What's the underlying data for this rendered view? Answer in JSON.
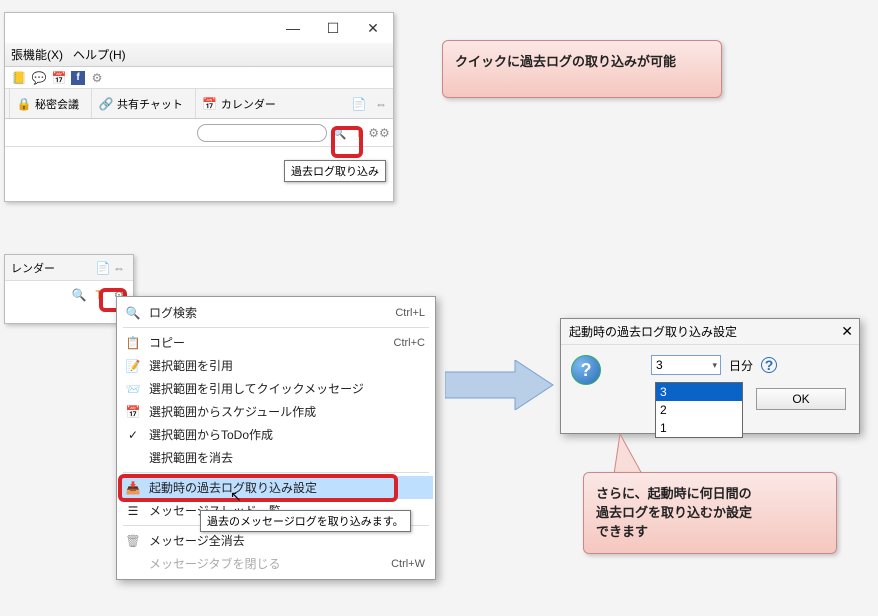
{
  "window1": {
    "menu1": "張機能(X)",
    "menu2": "ヘルプ(H)",
    "tool_secret": "秘密会議",
    "tool_chat": "共有チャット",
    "tool_calendar": "カレンダー",
    "tooltip": "過去ログ取り込み"
  },
  "callout1": {
    "text": "クイックに過去ログの取り込みが可能"
  },
  "window2": {
    "label": "レンダー"
  },
  "context_menu": {
    "items": [
      {
        "label": "ログ検索",
        "shortcut": "Ctrl+L"
      },
      {
        "label": "コピー",
        "shortcut": "Ctrl+C"
      },
      {
        "label": "選択範囲を引用",
        "shortcut": ""
      },
      {
        "label": "選択範囲を引用してクイックメッセージ",
        "shortcut": ""
      },
      {
        "label": "選択範囲からスケジュール作成",
        "shortcut": ""
      },
      {
        "label": "選択範囲からToDo作成",
        "shortcut": ""
      },
      {
        "label": "選択範囲を消去",
        "shortcut": ""
      },
      {
        "label": "起動時の過去ログ取り込み設定",
        "shortcut": ""
      },
      {
        "label": "メッセージスレッド一覧",
        "shortcut": ""
      },
      {
        "label": "メッセージ全消去",
        "shortcut": ""
      },
      {
        "label": "メッセージタブを閉じる",
        "shortcut": "Ctrl+W"
      }
    ],
    "tooltip": "過去のメッセージログを取り込みます。"
  },
  "dialog": {
    "title": "起動時の過去ログ取り込み設定",
    "selected": "3",
    "options": [
      "3",
      "2",
      "1"
    ],
    "day_label": "日分",
    "ok": "OK"
  },
  "callout2": {
    "line1": "さらに、起動時に何日間の",
    "line2": "過去ログを取り込むか設定",
    "line3": "できます"
  }
}
